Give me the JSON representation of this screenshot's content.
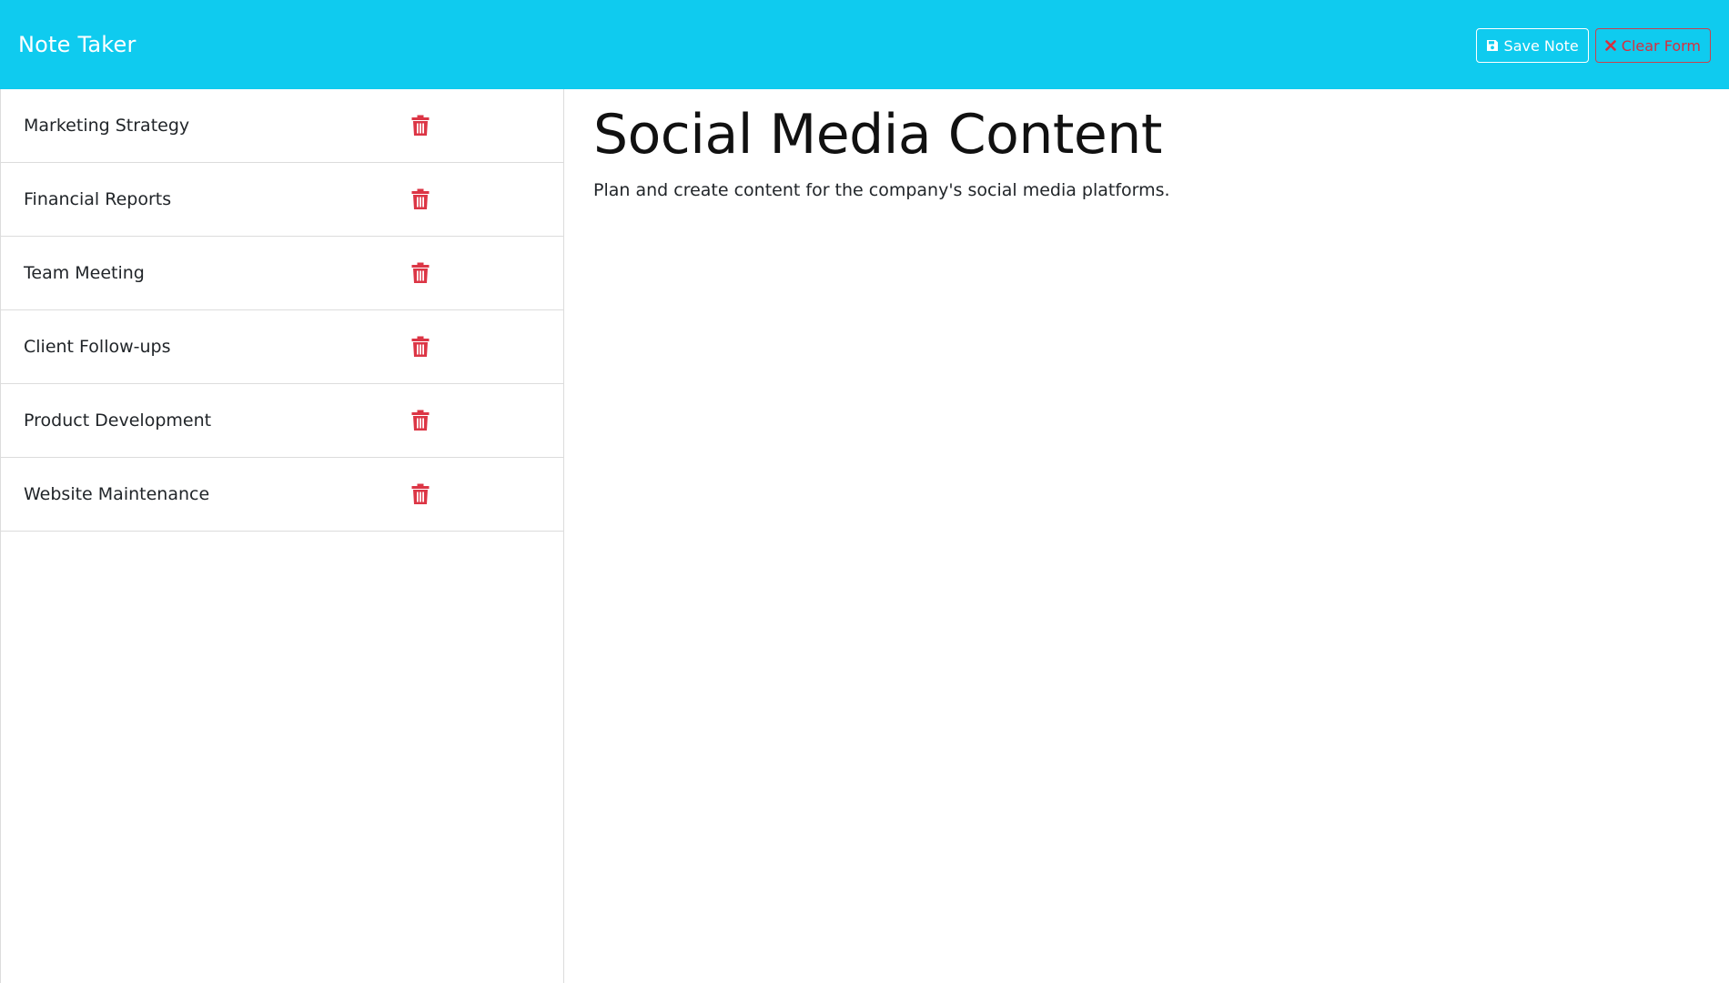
{
  "app": {
    "title": "Note Taker"
  },
  "toolbar": {
    "save_label": "Save Note",
    "save_icon": "floppy-disk-icon",
    "clear_label": "Clear Form",
    "clear_icon": "close-icon"
  },
  "colors": {
    "navbar": "#0fcbef",
    "danger": "#dc3545",
    "text": "#212529"
  },
  "sidebar": {
    "notes": [
      {
        "title": "Marketing Strategy",
        "icon": "trash-icon"
      },
      {
        "title": "Financial Reports",
        "icon": "trash-icon"
      },
      {
        "title": "Team Meeting",
        "icon": "trash-icon"
      },
      {
        "title": "Client Follow-ups",
        "icon": "trash-icon"
      },
      {
        "title": "Product Development",
        "icon": "trash-icon"
      },
      {
        "title": "Website Maintenance",
        "icon": "trash-icon"
      }
    ]
  },
  "main": {
    "note_title": "Social Media Content",
    "note_text": "Plan and create content for the company's social media platforms."
  }
}
